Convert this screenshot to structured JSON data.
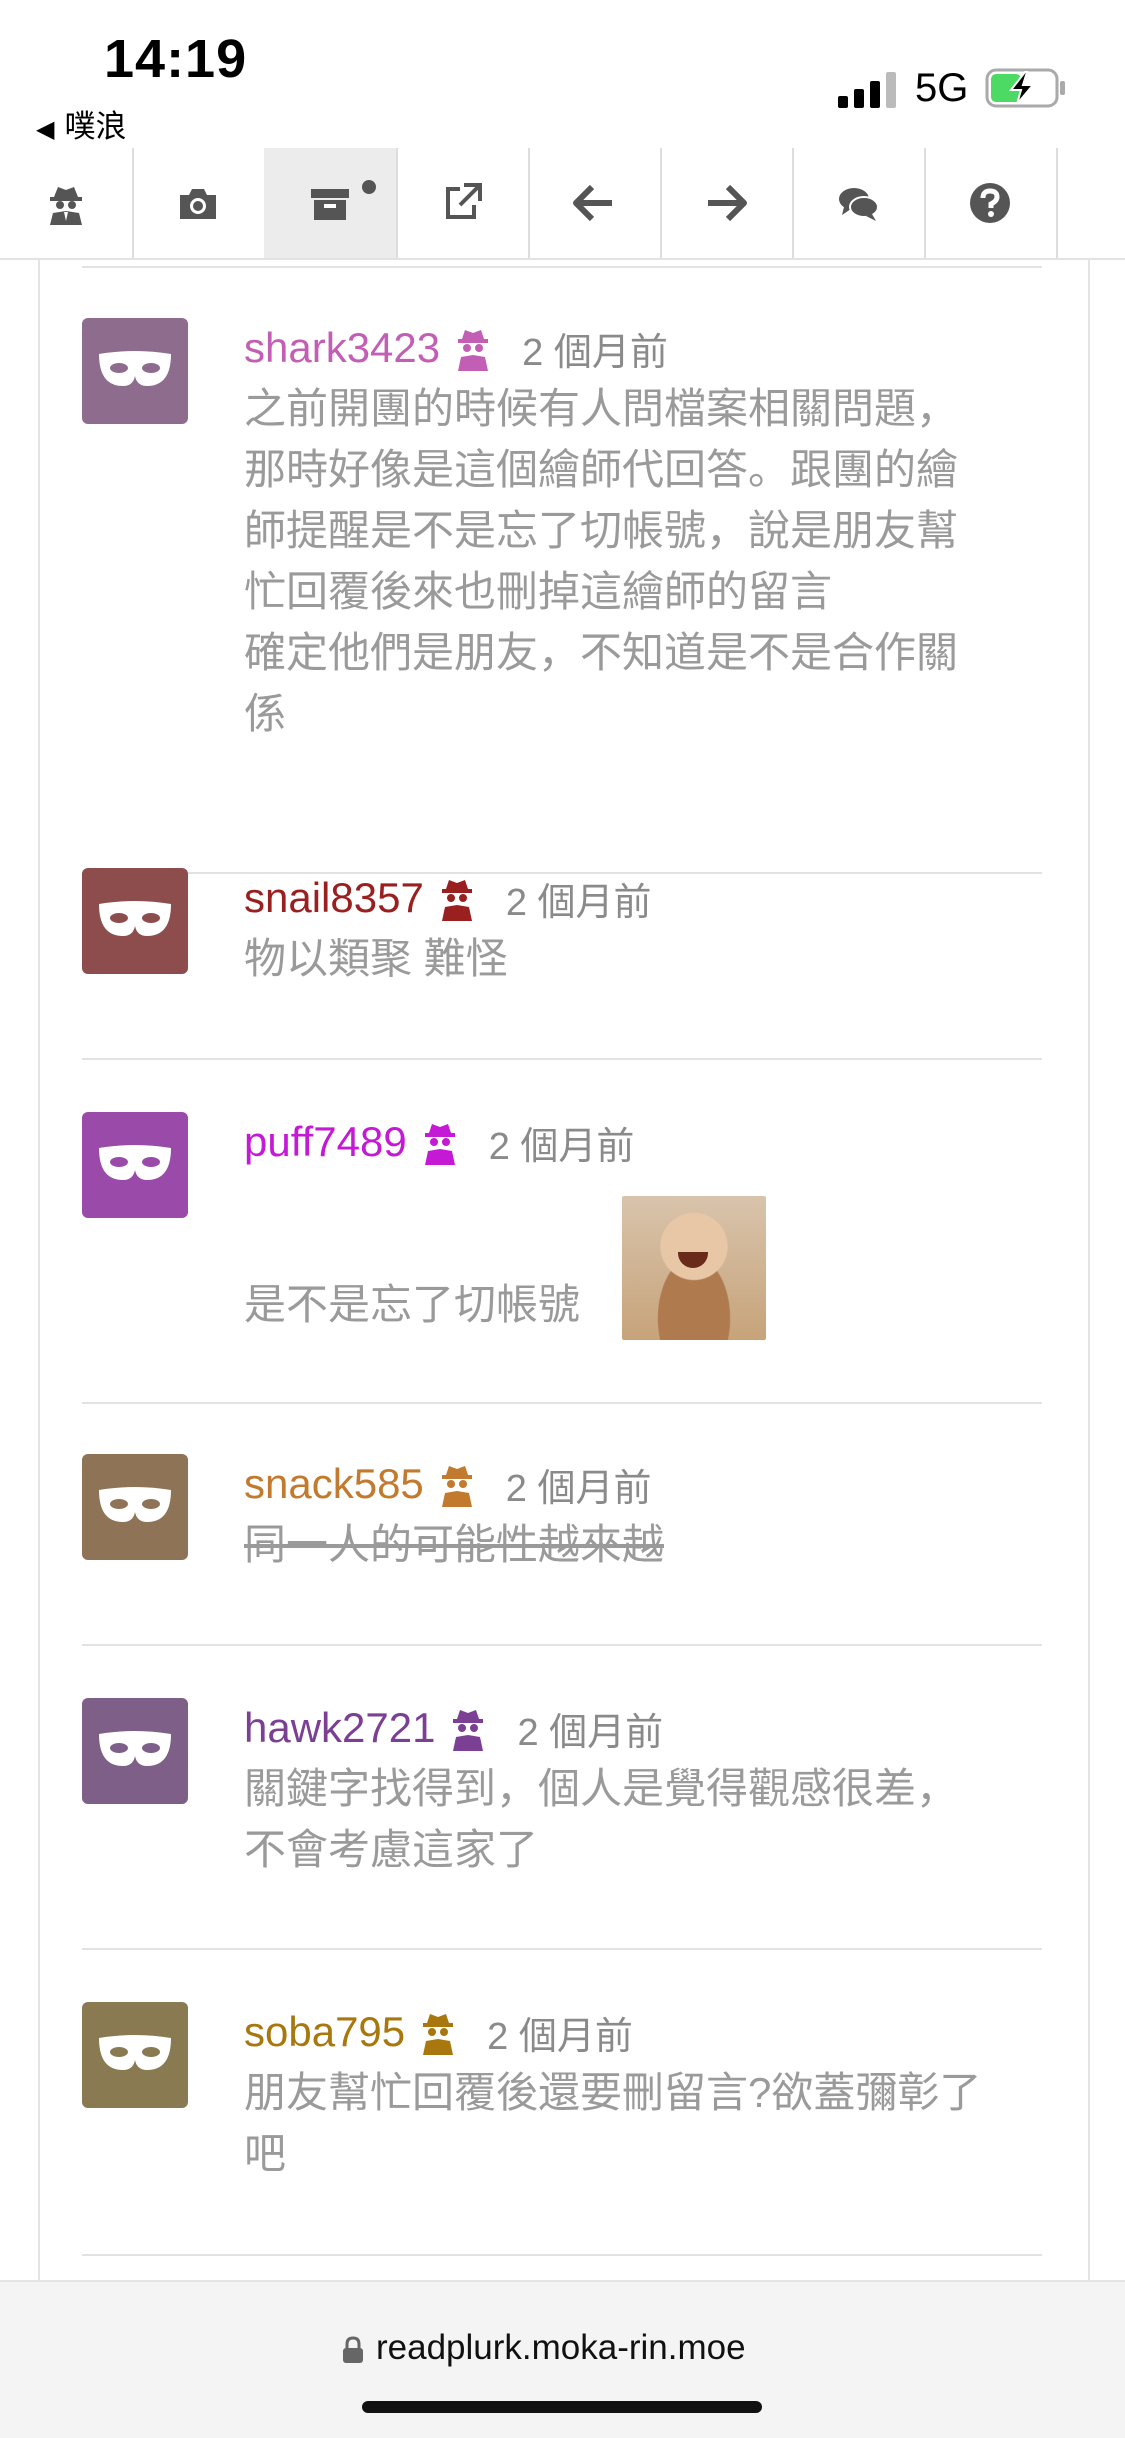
{
  "status_bar": {
    "time": "14:19",
    "back_app": "噗浪",
    "network": "5G"
  },
  "toolbar": {
    "tools": [
      {
        "name": "spy-icon",
        "active": false
      },
      {
        "name": "camera-icon",
        "active": false
      },
      {
        "name": "archive-icon",
        "active": true
      },
      {
        "name": "external-link-icon",
        "active": false
      },
      {
        "name": "arrow-left-icon",
        "active": false
      },
      {
        "name": "arrow-right-icon",
        "active": false
      },
      {
        "name": "comments-icon",
        "active": false
      },
      {
        "name": "question-icon",
        "active": false
      }
    ]
  },
  "comments": [
    {
      "user": "shark3423",
      "color": "#c25fb5",
      "avatar_color": "#8e6c8e",
      "time": "2 個月前",
      "lines": [
        "之前開團的時候有人問檔案相關問題，",
        "那時好像是這個繪師代回答。跟團的繪",
        "師提醒是不是忘了切帳號，說是朋友幫",
        "忙回覆後來也刪掉這繪師的留言",
        "確定他們是朋友，不知道是不是合作關",
        "係"
      ]
    },
    {
      "user": "snail8357",
      "color": "#9a1f1f",
      "avatar_color": "#8e4d4d",
      "time": "2 個月前",
      "lines": [
        "物以類聚 難怪"
      ]
    },
    {
      "user": "puff7489",
      "color": "#c41ad6",
      "avatar_color": "#9a4aa8",
      "time": "2 個月前",
      "lines": [
        "是不是忘了切帳號"
      ],
      "has_emoticon": true
    },
    {
      "user": "snack585",
      "color": "#c27a2e",
      "avatar_color": "#8e7356",
      "time": "2 個月前",
      "lines": [
        "同一人的可能性越來越"
      ],
      "strikethrough": true
    },
    {
      "user": "hawk2721",
      "color": "#7b3f94",
      "avatar_color": "#7e5f87",
      "time": "2 個月前",
      "lines": [
        "關鍵字找得到，個人是覺得觀感很差，",
        "不會考慮這家了"
      ]
    },
    {
      "user": "soba795",
      "color": "#a8770e",
      "avatar_color": "#8a7a52",
      "time": "2 個月前",
      "lines": [
        "朋友幫忙回覆後還要刪留言?欲蓋彌彰了",
        "吧"
      ]
    }
  ],
  "url_bar": {
    "url": "readplurk.moka-rin.moe"
  }
}
